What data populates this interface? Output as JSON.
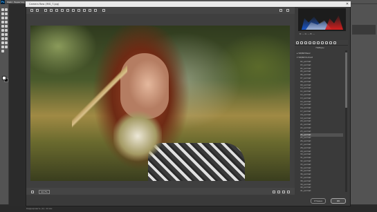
{
  "app": {
    "logo": "Ps",
    "menu": [
      "Файл",
      "Редактир.",
      "Изобр.",
      "Слои",
      "Текст",
      "Выдел.",
      "Фильтр",
      "3D",
      "Просм.",
      "Окно",
      "Справка"
    ]
  },
  "dialog": {
    "title": "Camera Raw (IMG_7.jpg)",
    "close_icon": "close-icon",
    "zoom_value": "42,7%",
    "image_info": "sRGB IEC61966-2.1; 8 бит; 2048 x 1365 (2.8 МП); 300 ppi",
    "cancel_label": "Отмена",
    "ok_label": "OK"
  },
  "histogram": {
    "readout": "R: ---  G: ---  B: ---",
    "colors": {
      "red": "#d21f1f",
      "blue": "#1a56c8",
      "luma": "#d8d8d8"
    }
  },
  "presets": {
    "header": "Наборы",
    "groups": [
      "ЧБ/BW Basic",
      "ЧБ/BW Portrait"
    ],
    "items": [
      "02_portrait",
      "03_portrait",
      "04_portrait",
      "05_portrait",
      "06_portrait",
      "07_portrait",
      "08_portrait",
      "09_portrait",
      "10_portrait",
      "11_portrait",
      "12_portrait",
      "13_portrait",
      "14_portrait",
      "15_portrait",
      "16_portrait",
      "17_portrait",
      "18_portrait",
      "19_portrait",
      "20_portrait",
      "21_portrait",
      "22_portrait",
      "23_portrait",
      "24_portrait",
      "25_portrait",
      "26_portrait",
      "27_portrait",
      "28_portrait",
      "29_portrait",
      "30_portrait",
      "31_portrait",
      "32_portrait",
      "33_portrait",
      "34_portrait",
      "35_portrait",
      "36_portrait",
      "37_portrait",
      "38_portrait",
      "39_portrait",
      "40_portrait",
      "41_portrait"
    ],
    "selected": "24_portrait"
  },
  "status": {
    "text": "Кадрировать (С): 24 мм"
  }
}
